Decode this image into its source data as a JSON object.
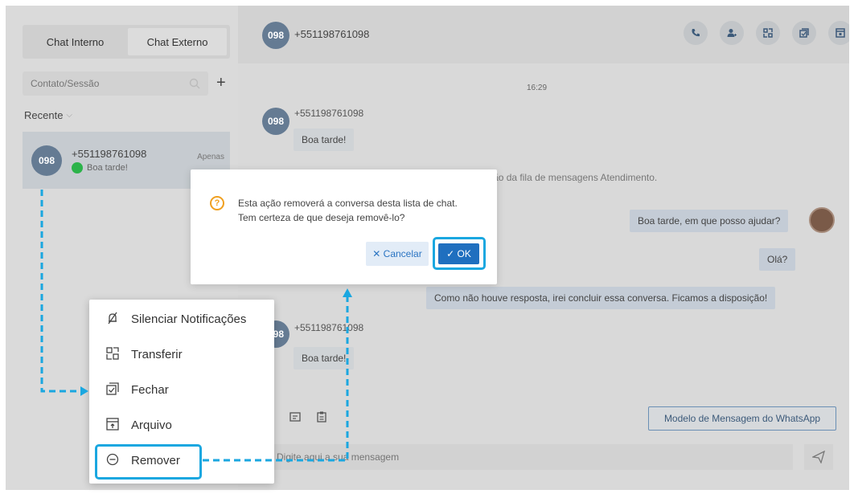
{
  "sidebar": {
    "tabs": [
      {
        "label": "Chat Interno"
      },
      {
        "label": "Chat Externo"
      }
    ],
    "search_placeholder": "Contato/Sessão",
    "add_label": "+",
    "recent_label": "Recente",
    "contacts": [
      {
        "avatar": "098",
        "name": "+551198761098",
        "last_message": "Boa tarde!",
        "tag": "Apenas"
      }
    ]
  },
  "header": {
    "avatar": "098",
    "title": "+551198761098",
    "actions": [
      {
        "icon": "phone-icon"
      },
      {
        "icon": "add-user-icon"
      },
      {
        "icon": "transfer-icon"
      },
      {
        "icon": "close-chat-icon"
      },
      {
        "icon": "archive-icon"
      }
    ]
  },
  "chat": {
    "time": "16:29",
    "sender_avatar": "098",
    "sender_name": "+551198761098",
    "msg1": "Boa tarde!",
    "system_message": "Rafael Almeida ... a sessão da fila de mensagens Atendimento.",
    "msg_agent": "Boa tarde, em que posso ajudar?",
    "msg_ola": "Olá?",
    "msg_close": "Como não houve resposta, irei concluir essa conversa. Ficamos a disposição!",
    "sender_name2": "+551198761098",
    "msg2": "Boa tarde!",
    "template_button": "Modelo de Mensagem do WhatsApp",
    "compose_placeholder": "Digite aqui a sua mensagem"
  },
  "dialog": {
    "line1": "Esta ação removerá a conversa desta lista de chat.",
    "line2": "Tem certeza de que deseja removê-lo?",
    "cancel_label": "✕ Cancelar",
    "ok_label": "✓ OK"
  },
  "context_menu": {
    "items": [
      {
        "label": "Silenciar Notificações",
        "icon": "mute-bell-icon"
      },
      {
        "label": "Transferir",
        "icon": "transfer-icon"
      },
      {
        "label": "Fechar",
        "icon": "close-chat-icon"
      },
      {
        "label": "Arquivo",
        "icon": "archive-icon"
      },
      {
        "label": "Remover",
        "icon": "remove-icon"
      }
    ]
  },
  "colors": {
    "accent": "#1f6fbf",
    "highlight": "#1aa7e0",
    "warning": "#f0a020",
    "whatsapp": "#2cb34a"
  }
}
